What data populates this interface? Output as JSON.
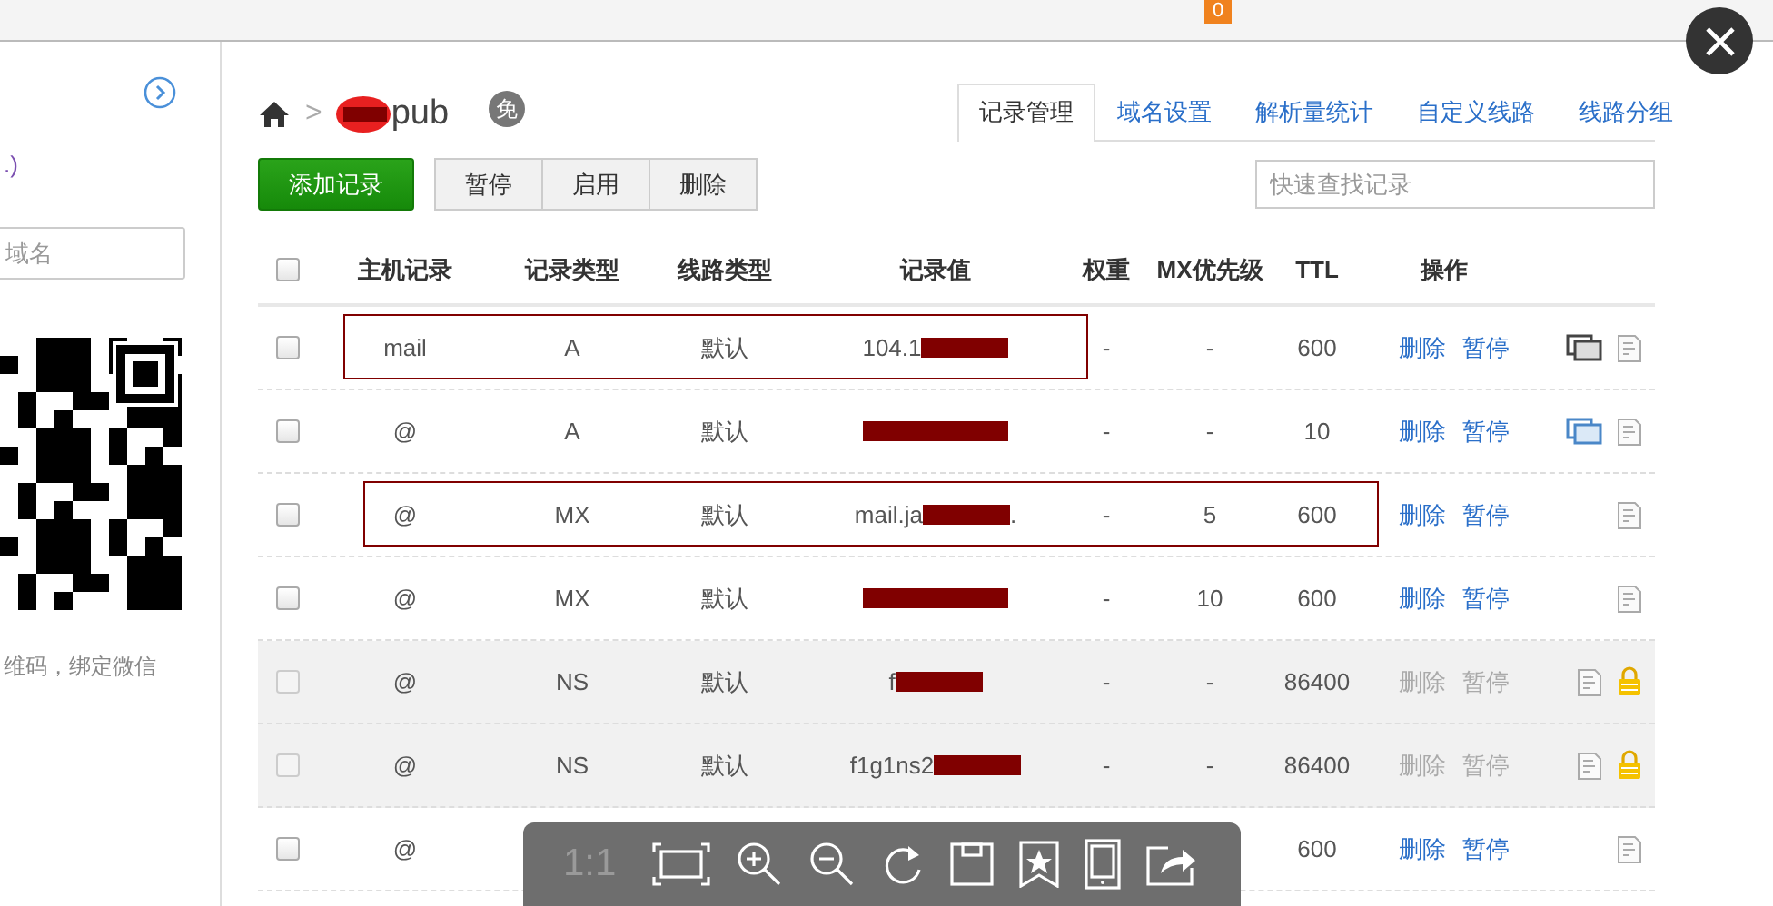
{
  "top_bar": {
    "badge": "0"
  },
  "sidebar": {
    "text_top": ".)",
    "search": {
      "placeholder": "域名"
    },
    "caption": "维码，绑定微信"
  },
  "breadcrumb": {
    "separator": ">",
    "domain": [
      {
        "kind": "redaction"
      },
      {
        "kind": "text",
        "text": "pub"
      }
    ],
    "badge": "免"
  },
  "tabs": [
    {
      "label": "记录管理",
      "selected": true
    },
    {
      "label": "域名设置",
      "selected": false
    },
    {
      "label": "解析量统计",
      "selected": false
    },
    {
      "label": "自定义线路",
      "selected": false
    },
    {
      "label": "线路分组",
      "selected": false
    }
  ],
  "actions": {
    "primary": "添加记录",
    "group": [
      "暂停",
      "启用",
      "删除"
    ],
    "search": {
      "placeholder": "快速查找记录"
    }
  },
  "table": {
    "select_all": {
      "checked": false
    },
    "columns": [
      "主机记录",
      "记录类型",
      "线路类型",
      "记录值",
      "权重",
      "MX优先级",
      "TTL",
      "操作"
    ],
    "rows": [
      {
        "checked": false,
        "disabled": false,
        "outlined": true,
        "host": "mail",
        "type": "A",
        "line": "默认",
        "value": [
          {
            "kind": "text",
            "text": "104.1"
          },
          {
            "kind": "redaction"
          }
        ],
        "weight": "-",
        "mx": "-",
        "ttl": "600",
        "ops": [
          "删除",
          "暂停"
        ],
        "icons": [
          {
            "kind": "monitor",
            "on": false
          },
          {
            "kind": "note"
          }
        ]
      },
      {
        "checked": false,
        "disabled": false,
        "host": "@",
        "type": "A",
        "line": "默认",
        "value": [
          {
            "kind": "redaction"
          }
        ],
        "weight": "-",
        "mx": "-",
        "ttl": "10",
        "ops": [
          "删除",
          "暂停"
        ],
        "icons": [
          {
            "kind": "monitor",
            "on": true
          },
          {
            "kind": "note"
          }
        ]
      },
      {
        "checked": false,
        "disabled": false,
        "outlined": true,
        "host": "@",
        "type": "MX",
        "line": "默认",
        "value": [
          {
            "kind": "text",
            "text": "mail.ja"
          },
          {
            "kind": "redaction"
          },
          {
            "kind": "text",
            "text": "."
          }
        ],
        "weight": "-",
        "mx": "5",
        "ttl": "600",
        "ops": [
          "删除",
          "暂停"
        ],
        "icons": [
          {
            "kind": "note"
          }
        ]
      },
      {
        "checked": false,
        "disabled": false,
        "host": "@",
        "type": "MX",
        "line": "默认",
        "value": [
          {
            "kind": "redaction"
          }
        ],
        "weight": "-",
        "mx": "10",
        "ttl": "600",
        "ops": [
          "删除",
          "暂停"
        ],
        "icons": [
          {
            "kind": "note"
          }
        ]
      },
      {
        "checked": false,
        "disabled": true,
        "host": "@",
        "type": "NS",
        "line": "默认",
        "value": [
          {
            "kind": "text",
            "text": "f"
          },
          {
            "kind": "redaction"
          }
        ],
        "weight": "-",
        "mx": "-",
        "ttl": "86400",
        "ops": [
          "删除",
          "暂停"
        ],
        "icons": [
          {
            "kind": "note"
          },
          {
            "kind": "lock"
          }
        ]
      },
      {
        "checked": false,
        "disabled": true,
        "host": "@",
        "type": "NS",
        "line": "默认",
        "value": [
          {
            "kind": "text",
            "text": "f1g1ns2"
          },
          {
            "kind": "redaction"
          }
        ],
        "weight": "-",
        "mx": "-",
        "ttl": "86400",
        "ops": [
          "删除",
          "暂停"
        ],
        "icons": [
          {
            "kind": "note"
          },
          {
            "kind": "lock"
          }
        ]
      },
      {
        "checked": false,
        "disabled": false,
        "host": "@",
        "ttl": "600",
        "ops": [
          "删除",
          "暂停"
        ],
        "icons": [
          {
            "kind": "note"
          }
        ]
      }
    ]
  },
  "viewer_toolbar": [
    {
      "kind": "text",
      "text": "1:1"
    },
    {
      "kind": "fit"
    },
    {
      "kind": "zoom-in"
    },
    {
      "kind": "zoom-out"
    },
    {
      "kind": "rotate"
    },
    {
      "kind": "save"
    },
    {
      "kind": "bookmark"
    },
    {
      "kind": "tablet"
    },
    {
      "kind": "share"
    }
  ]
}
